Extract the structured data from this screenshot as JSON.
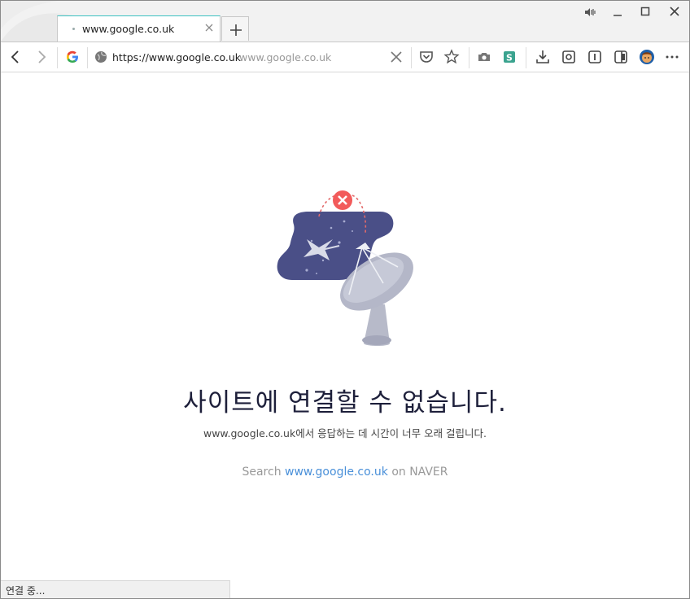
{
  "tab": {
    "title": "www.google.co.uk"
  },
  "address_bar": {
    "url": "https://www.google.co.uk",
    "hint": "www.google.co.uk"
  },
  "error": {
    "title": "사이트에 연결할 수 없습니다.",
    "description": "www.google.co.uk에서 응답하는 데 시간이 너무 오래 걸립니다."
  },
  "search": {
    "prefix": "Search",
    "link": "www.google.co.uk",
    "suffix": "on NAVER"
  },
  "status_bar": {
    "text": "연결 중..."
  },
  "icons": {
    "back": "chevron-left-icon",
    "forward": "chevron-right-icon",
    "google": "google-g-icon",
    "site": "globe-icon",
    "clear": "close-icon",
    "pocket": "pocket-icon",
    "bookmark": "star-icon",
    "camera": "camera-icon",
    "s_ext": "s-extension-icon",
    "download": "download-icon",
    "capture": "capture-icon",
    "reader": "reader-icon",
    "sidebar": "sidebar-icon",
    "profile": "avatar",
    "menu": "more-icon"
  },
  "colors": {
    "accent": "#3cc1c1",
    "link": "#4a90d9",
    "error_red": "#f25b5b",
    "space_blue": "#4a4f87"
  }
}
